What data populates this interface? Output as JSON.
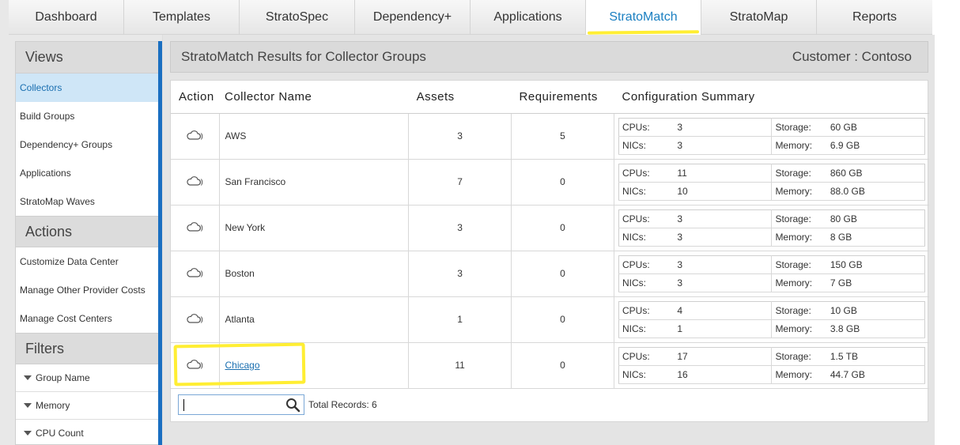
{
  "tabs": [
    "Dashboard",
    "Templates",
    "StratoSpec",
    "Dependency+",
    "Applications",
    "StratoMatch",
    "StratoMap",
    "Reports"
  ],
  "active_tab": "StratoMatch",
  "sidebar": {
    "views_title": "Views",
    "views": [
      "Collectors",
      "Build Groups",
      "Dependency+ Groups",
      "Applications",
      "StratoMap Waves"
    ],
    "selected_view": "Collectors",
    "actions_title": "Actions",
    "actions": [
      "Customize Data Center",
      "Manage Other Provider Costs",
      "Manage Cost Centers"
    ],
    "filters_title": "Filters",
    "filters": [
      "Group Name",
      "Memory",
      "CPU Count"
    ]
  },
  "header": {
    "title": "StratoMatch Results for Collector Groups",
    "customer": "Customer : Contoso"
  },
  "table": {
    "columns": [
      "Action",
      "Collector Name",
      "Assets",
      "Requirements",
      "Configuration Summary"
    ],
    "config_labels": {
      "cpus": "CPUs:",
      "nics": "NICs:",
      "storage": "Storage:",
      "memory": "Memory:"
    },
    "rows": [
      {
        "name": "AWS",
        "assets": "3",
        "requirements": "5",
        "cpus": "3",
        "nics": "3",
        "storage": "60 GB",
        "memory": "6.9 GB"
      },
      {
        "name": "San Francisco",
        "assets": "7",
        "requirements": "0",
        "cpus": "11",
        "nics": "10",
        "storage": "860 GB",
        "memory": "88.0 GB"
      },
      {
        "name": "New York",
        "assets": "3",
        "requirements": "0",
        "cpus": "3",
        "nics": "3",
        "storage": "80 GB",
        "memory": "8 GB"
      },
      {
        "name": "Boston",
        "assets": "3",
        "requirements": "0",
        "cpus": "3",
        "nics": "3",
        "storage": "150 GB",
        "memory": "7 GB"
      },
      {
        "name": "Atlanta",
        "assets": "1",
        "requirements": "0",
        "cpus": "4",
        "nics": "1",
        "storage": "10 GB",
        "memory": "3.8 GB"
      },
      {
        "name": "Chicago",
        "assets": "11",
        "requirements": "0",
        "cpus": "17",
        "nics": "16",
        "storage": "1.5 TB",
        "memory": "44.7 GB"
      }
    ]
  },
  "search": {
    "value": "",
    "placeholder": ""
  },
  "total_records": "Total Records: 6",
  "colors": {
    "accent": "#1a7fc1",
    "highlight": "#ffee33"
  },
  "icons": {
    "row_action": "cloud-icon",
    "search": "search-icon"
  }
}
